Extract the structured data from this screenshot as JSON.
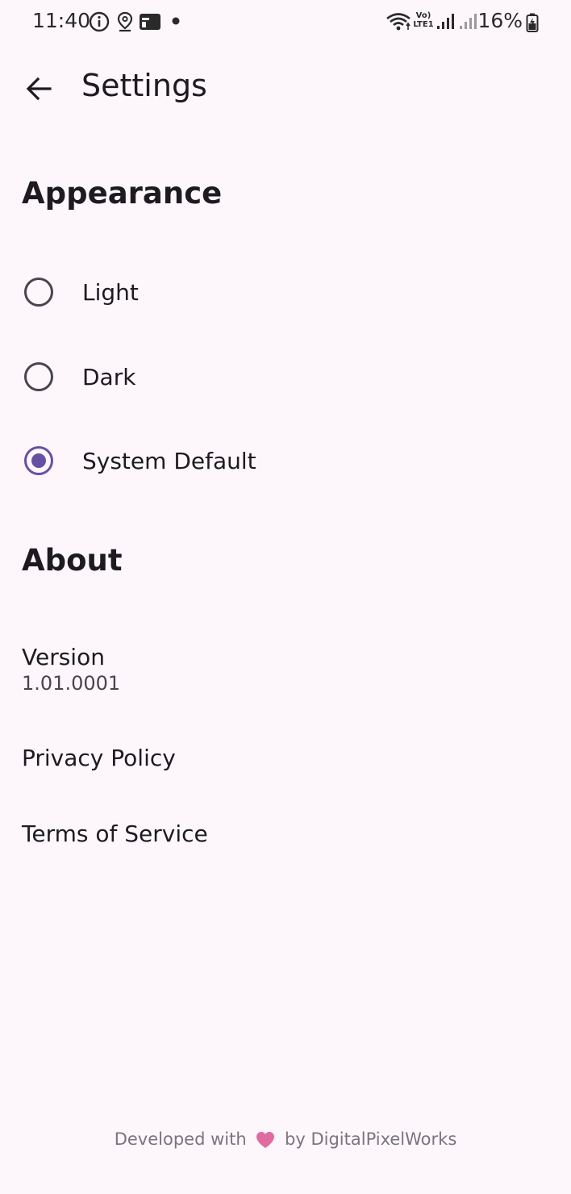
{
  "status_bar": {
    "time": "11:40",
    "battery": "16%",
    "network": "VoLTE1"
  },
  "app_bar": {
    "title": "Settings"
  },
  "appearance": {
    "title": "Appearance",
    "options": [
      {
        "label": "Light",
        "selected": false
      },
      {
        "label": "Dark",
        "selected": false
      },
      {
        "label": "System Default",
        "selected": true
      }
    ]
  },
  "about": {
    "title": "About",
    "version_label": "Version",
    "version_value": "1.01.0001",
    "privacy_label": "Privacy Policy",
    "terms_label": "Terms of Service"
  },
  "footer": {
    "prefix": "Developed with",
    "suffix": "by DigitalPixelWorks"
  },
  "colors": {
    "background": "#fdf7fc",
    "accent": "#6750a4",
    "heart": "#e06ba0"
  }
}
